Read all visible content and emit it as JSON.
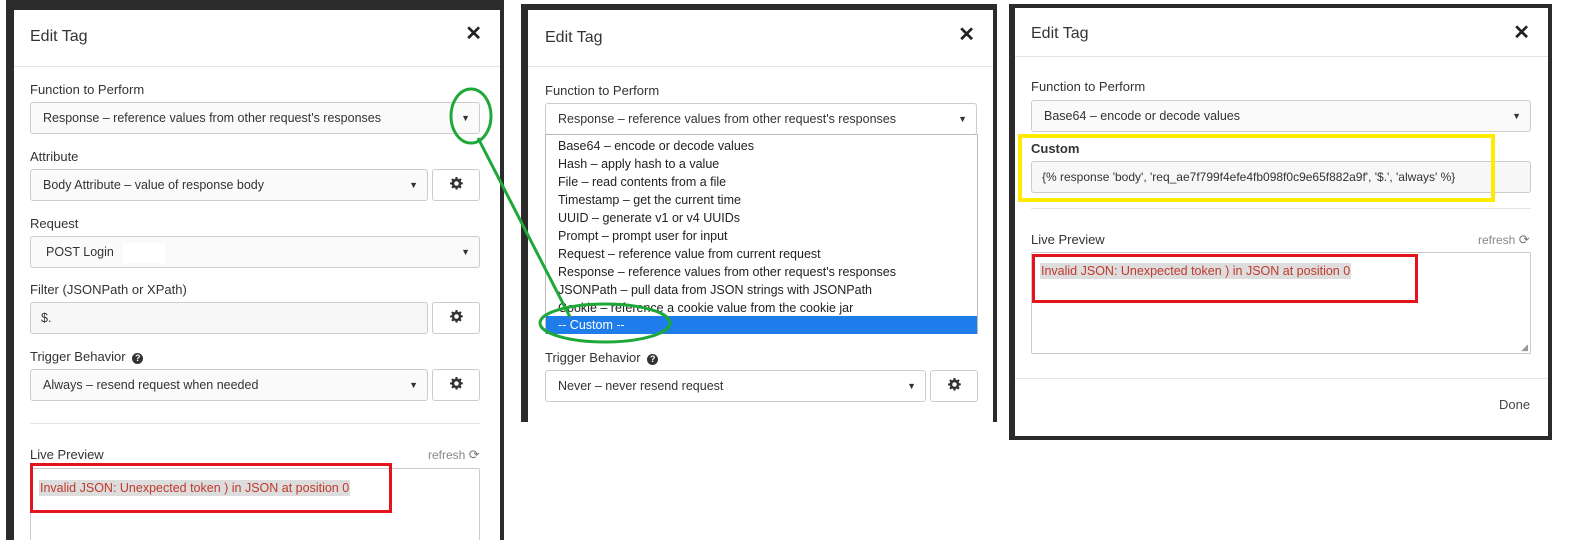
{
  "panel1": {
    "title": "Edit Tag",
    "close_icon": "times-icon",
    "function_label": "Function to Perform",
    "function_value": "Response – reference values from other request's responses",
    "attribute_label": "Attribute",
    "attribute_value": "Body Attribute – value of response body",
    "request_label": "Request",
    "request_value": "POST Login",
    "filter_label": "Filter (JSONPath or XPath)",
    "filter_value": "$.",
    "trigger_label": "Trigger Behavior",
    "trigger_value": "Always – resend request when needed",
    "live_preview_label": "Live Preview",
    "refresh_label": "refresh",
    "error_text": "Invalid JSON: Unexpected token ) in JSON at position 0"
  },
  "panel2": {
    "title": "Edit Tag",
    "function_label": "Function to Perform",
    "function_value": "Response – reference values from other request's responses",
    "options": [
      "Base64 – encode or decode values",
      "Hash – apply hash to a value",
      "File – read contents from a file",
      "Timestamp – get the current time",
      "UUID – generate v1 or v4 UUIDs",
      "Prompt – prompt user for input",
      "Request – reference value from current request",
      "Response – reference values from other request's responses",
      "JSONPath – pull data from JSON strings with JSONPath",
      "Cookie – reference a cookie value from the cookie jar"
    ],
    "selected_option": "-- Custom --",
    "trigger_label": "Trigger Behavior",
    "trigger_value": "Never – never resend request"
  },
  "panel3": {
    "title": "Edit Tag",
    "function_label": "Function to Perform",
    "function_value": "Base64 – encode or decode values",
    "custom_label": "Custom",
    "custom_value": "{% response 'body', 'req_ae7f799f4efe4fb098f0c9e65f882a9f', '$.', 'always' %}",
    "live_preview_label": "Live Preview",
    "refresh_label": "refresh",
    "error_text": "Invalid JSON: Unexpected token ) in JSON at position 0",
    "done_label": "Done"
  },
  "colors": {
    "annotation_red": "#e3141c",
    "annotation_green": "#1fa83a",
    "annotation_yellow": "#ffea00",
    "selected_option": "#1e7dea",
    "error_text": "#c0392b"
  }
}
